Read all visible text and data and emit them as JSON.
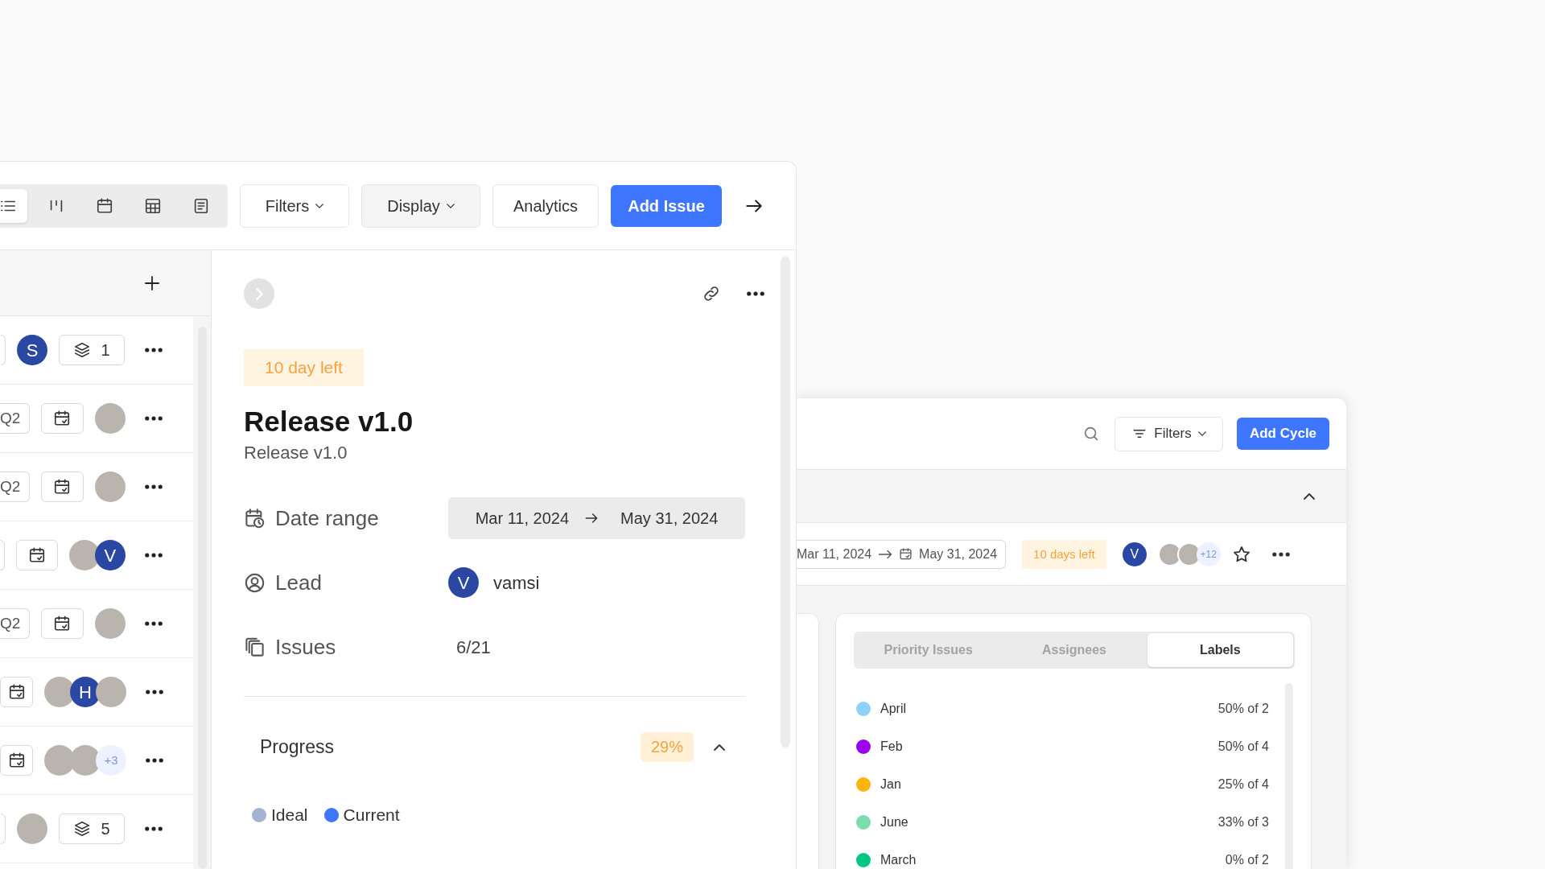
{
  "issues_window": {
    "toolbar": {
      "view_buttons": [
        {
          "kind": "list",
          "selected": true
        },
        {
          "kind": "columns",
          "selected": false
        },
        {
          "kind": "calendar",
          "selected": false
        },
        {
          "kind": "grid",
          "selected": false
        },
        {
          "kind": "document",
          "selected": false
        }
      ],
      "buttons": [
        {
          "label": "Filters",
          "kind": "dropdown"
        },
        {
          "label": "Display",
          "kind": "dropdown-muted"
        },
        {
          "label": "Analytics",
          "kind": "plain"
        },
        {
          "label": "Add Issue",
          "kind": "primary"
        }
      ]
    },
    "rows": [
      {
        "items": [
          {
            "kind": "edge"
          },
          {
            "kind": "avatars",
            "avatars": [
              {
                "kind": "letter",
                "text": "S"
              }
            ]
          },
          {
            "kind": "count",
            "text": "1"
          }
        ]
      },
      {
        "items": [
          {
            "kind": "tag",
            "text": "Q2"
          },
          {
            "kind": "calendar"
          },
          {
            "kind": "avatars",
            "avatars": [
              {
                "kind": "photo"
              }
            ]
          }
        ]
      },
      {
        "items": [
          {
            "kind": "tag",
            "text": "Q2"
          },
          {
            "kind": "calendar"
          },
          {
            "kind": "avatars",
            "avatars": [
              {
                "kind": "photo"
              }
            ]
          }
        ]
      },
      {
        "items": [
          {
            "kind": "edge"
          },
          {
            "kind": "calendar"
          },
          {
            "kind": "avatars",
            "avatars": [
              {
                "kind": "photo"
              },
              {
                "kind": "letter",
                "text": "V"
              }
            ]
          }
        ]
      },
      {
        "items": [
          {
            "kind": "tag",
            "text": "Q2"
          },
          {
            "kind": "calendar"
          },
          {
            "kind": "avatars",
            "avatars": [
              {
                "kind": "photo"
              }
            ]
          }
        ]
      },
      {
        "items": [
          {
            "kind": "calendar"
          },
          {
            "kind": "avatars",
            "avatars": [
              {
                "kind": "photo"
              },
              {
                "kind": "letter",
                "text": "H"
              },
              {
                "kind": "photo"
              }
            ]
          }
        ]
      },
      {
        "items": [
          {
            "kind": "calendar"
          },
          {
            "kind": "avatars",
            "avatars": [
              {
                "kind": "photo"
              },
              {
                "kind": "photo"
              },
              {
                "kind": "more",
                "text": "+3"
              }
            ]
          }
        ]
      },
      {
        "items": [
          {
            "kind": "edge"
          },
          {
            "kind": "avatars",
            "avatars": [
              {
                "kind": "photo"
              }
            ]
          },
          {
            "kind": "count",
            "text": "5"
          }
        ]
      }
    ],
    "cycle_detail": {
      "days_left": "10 day left",
      "title": "Release v1.0",
      "subtitle": "Release v1.0",
      "properties": [
        {
          "kind": "date_range",
          "label": "Date range",
          "start": "Mar 11, 2024",
          "end": "May 31, 2024"
        },
        {
          "kind": "lead",
          "label": "Lead",
          "avatar": "V",
          "value": "vamsi"
        },
        {
          "kind": "issues",
          "label": "Issues",
          "value": "6/21"
        }
      ],
      "progress": {
        "label": "Progress",
        "percent": "29%",
        "expanded": true,
        "legend": [
          {
            "label": "Ideal",
            "color": "#a3b3d1"
          },
          {
            "label": "Current",
            "color": "#3f76ff"
          }
        ]
      }
    }
  },
  "cycles_window": {
    "filters_label": "Filters",
    "add_button": "Add Cycle",
    "group_expanded": true,
    "cycle_row": {
      "start": "Mar 11, 2024",
      "end": "May 31, 2024",
      "days_left": "10 days left",
      "lead": "V",
      "members": [
        {
          "kind": "photo"
        },
        {
          "kind": "photo"
        },
        {
          "kind": "more",
          "text": "+12"
        }
      ],
      "favorite": false
    },
    "tabs": [
      {
        "label": "Priority Issues",
        "selected": false
      },
      {
        "label": "Assignees",
        "selected": false
      },
      {
        "label": "Labels",
        "selected": true
      }
    ],
    "labels": [
      {
        "name": "April",
        "value": "50% of 2",
        "color": "#8fd0fb"
      },
      {
        "name": "Feb",
        "value": "50% of 4",
        "color": "#9b00f0"
      },
      {
        "name": "Jan",
        "value": "25% of 4",
        "color": "#fbb40a"
      },
      {
        "name": "June",
        "value": "33% of 3",
        "color": "#7ddbb0"
      },
      {
        "name": "March",
        "value": "0% of 2",
        "color": "#00c77f"
      }
    ]
  }
}
